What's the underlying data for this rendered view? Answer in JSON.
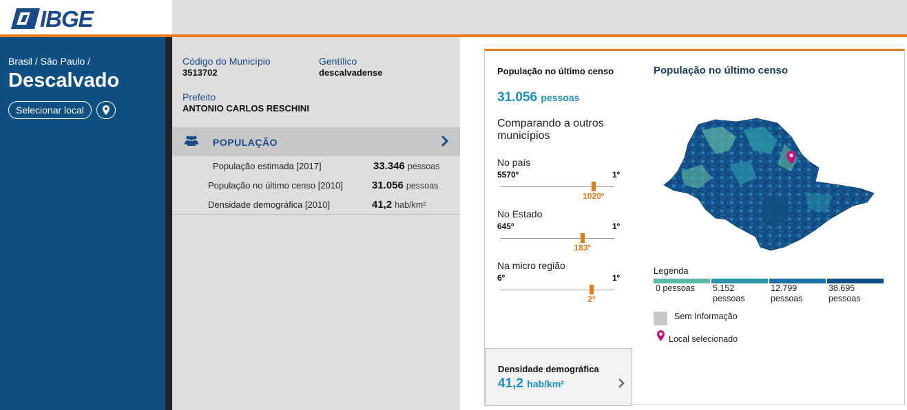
{
  "header": {
    "logo_text": "IBGE"
  },
  "sidebar": {
    "breadcrumb": "Brasil / São Paulo /",
    "title": "Descalvado",
    "select_button": "Selecionar local"
  },
  "info": {
    "codigo_label": "Código do Município",
    "codigo_value": "3513702",
    "gentilico_label": "Gentílico",
    "gentilico_value": "descalvadense",
    "prefeito_label": "Prefeito",
    "prefeito_value": "ANTONIO CARLOS RESCHINI"
  },
  "populacao_section": {
    "title": "POPULAÇÃO",
    "rows": [
      {
        "label": "População estimada [2017]",
        "value": "33.346",
        "unit": "pessoas"
      },
      {
        "label": "População no último censo [2010]",
        "value": "31.056",
        "unit": "pessoas"
      },
      {
        "label": "Densidade demográfica [2010]",
        "value": "41,2",
        "unit": "hab/km²"
      }
    ]
  },
  "panel": {
    "pop_label": "População no último censo",
    "pop_value": "31.056",
    "pop_unit": "pessoas",
    "compare_title": "Comparando a outros municípios",
    "rankings": [
      {
        "label": "No país",
        "min": "5570º",
        "max": "1º",
        "value": "1020º",
        "fraction": 0.817
      },
      {
        "label": "No Estado",
        "min": "645º",
        "max": "1º",
        "value": "183º",
        "fraction": 0.72
      },
      {
        "label": "Na micro região",
        "min": "6º",
        "max": "1º",
        "value": "2º",
        "fraction": 0.8
      }
    ],
    "map_title": "População no último censo",
    "legend_title": "Legenda",
    "legend": [
      {
        "color": "#5fb8a4",
        "label_line1": "0 pessoas",
        "label_line2": ""
      },
      {
        "color": "#2a96a8",
        "label_line1": "5.152",
        "label_line2": "pessoas"
      },
      {
        "color": "#1e6fa8",
        "label_line1": "12.799",
        "label_line2": "pessoas"
      },
      {
        "color": "#124f80",
        "label_line1": "38.695",
        "label_line2": "pessoas"
      }
    ],
    "no_info_label": "Sem Informação",
    "selected_label": "Local selecionado",
    "density_label": "Densidade demográfica",
    "density_value": "41,2",
    "density_unit": "hab/km²"
  },
  "colors": {
    "brand_blue": "#0d4f80",
    "accent_orange": "#e87c1e",
    "value_blue": "#1e8db9"
  }
}
